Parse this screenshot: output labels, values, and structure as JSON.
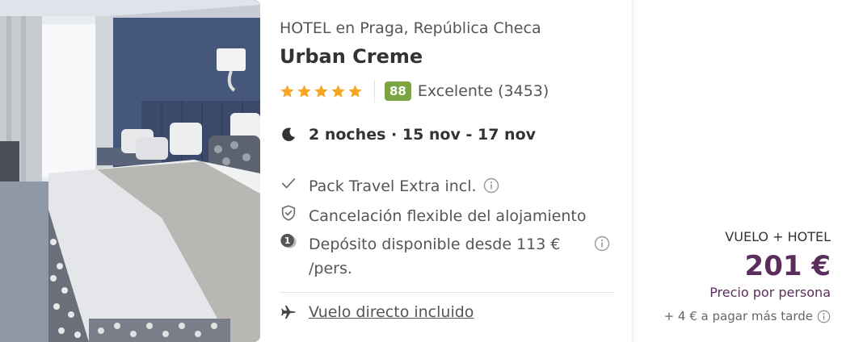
{
  "hotel": {
    "location": "HOTEL en Praga, República Checa",
    "name": "Urban Creme",
    "stars": 5,
    "score": "88",
    "rating_text": "Excelente (3453)"
  },
  "stay": {
    "nights": "2 noches · 15 nov - 17 nov"
  },
  "features": [
    {
      "icon": "check-icon",
      "label": "Pack Travel Extra incl."
    },
    {
      "icon": "shield-icon",
      "label": "Cancelación flexible del alojamiento"
    },
    {
      "icon": "deposit-coin-icon",
      "label": "Depósito disponible desde 113 € /pers."
    }
  ],
  "flight": {
    "icon": "plane-icon",
    "label": "Vuelo directo incluido"
  },
  "pricing": {
    "pack_label": "VUELO + HOTEL",
    "price": "201 €",
    "per_person": "Precio por persona",
    "pay_later": "+ 4 € a pagar más tarde"
  },
  "colors": {
    "star": "#f5a623",
    "score_badge": "#7ba542",
    "price": "#5a2d5c"
  }
}
